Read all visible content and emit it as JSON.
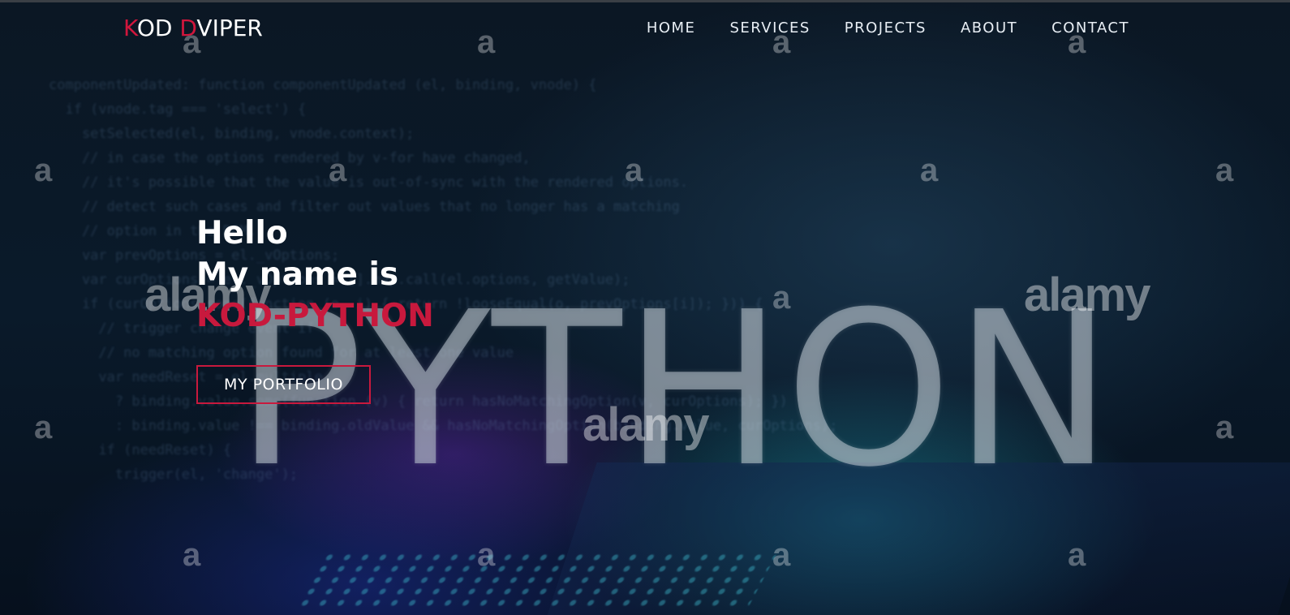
{
  "nav": {
    "logo_parts": [
      "K",
      "OD ",
      "D",
      "VIPER"
    ],
    "items": [
      "HOME",
      "SERVICES",
      "PROJECTS",
      "ABOUT",
      "CONTACT"
    ]
  },
  "hero": {
    "line1": "Hello",
    "line2": "My name is",
    "name": "KOD-PYTHON",
    "button": "MY PORTFOLIO",
    "background_word": "PYTHON",
    "code_lines": [
      "componentUpdated: function componentUpdated (el, binding, vnode) {",
      "  if (vnode.tag === 'select') {",
      "    setSelected(el, binding, vnode.context);",
      "    // in case the options rendered by v-for have changed,",
      "    // it's possible that the value is out-of-sync with the rendered options.",
      "    // detect such cases and filter out values that no longer has a matching",
      "    // option in the DOM.",
      "    var prevOptions = el._vOptions;",
      "    var curOptions = el._vOptions = [].map.call(el.options, getValue);",
      "    if (curOptions.some(function (o, i) { return !looseEqual(o, prevOptions[i]); })) {",
      "      // trigger change event if",
      "      // no matching option found for at least one value",
      "      var needReset = el.multiple",
      "        ? binding.value.some(function (v) { return hasNoMatchingOption(v, curOptions); })",
      "        : binding.value !== binding.oldValue && hasNoMatchingOption(binding.value, curOptions);",
      "      if (needReset) {",
      "        trigger(el, 'change');"
    ]
  },
  "watermark": {
    "letter": "a",
    "brand": "alamy"
  },
  "colors": {
    "accent": "#c8193d",
    "text": "#ffffff",
    "background": "#0a1a2a"
  }
}
